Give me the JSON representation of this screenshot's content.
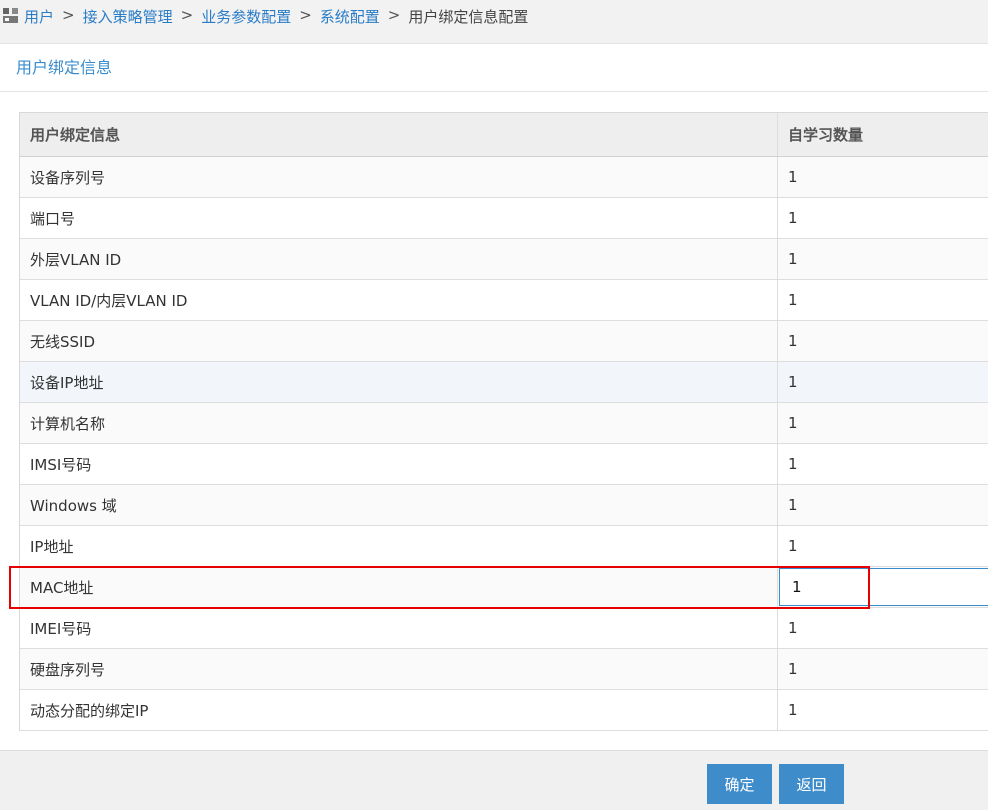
{
  "breadcrumb": {
    "items": [
      "用户",
      "接入策略管理",
      "业务参数配置",
      "系统配置"
    ],
    "separator": ">",
    "current": "用户绑定信息配置"
  },
  "section": {
    "title": "用户绑定信息"
  },
  "table": {
    "columns": [
      "用户绑定信息",
      "自学习数量"
    ],
    "rows": [
      [
        "设备序列号",
        "1"
      ],
      [
        "端口号",
        "1"
      ],
      [
        "外层VLAN ID",
        "1"
      ],
      [
        "VLAN ID/内层VLAN ID",
        "1"
      ],
      [
        "无线SSID",
        "1"
      ],
      [
        "设备IP地址",
        "1"
      ],
      [
        "计算机名称",
        "1"
      ],
      [
        "IMSI号码",
        "1"
      ],
      [
        "Windows 域",
        "1"
      ],
      [
        "IP地址",
        "1"
      ],
      [
        "MAC地址",
        "1"
      ],
      [
        "IMEI号码",
        "1"
      ],
      [
        "硬盘序列号",
        "1"
      ],
      [
        "动态分配的绑定IP",
        "1"
      ]
    ]
  },
  "buttons": {
    "ok": "确定",
    "back": "返回"
  },
  "colors": {
    "accent": "#3f8ccb",
    "highlight_box": "#e60000"
  }
}
